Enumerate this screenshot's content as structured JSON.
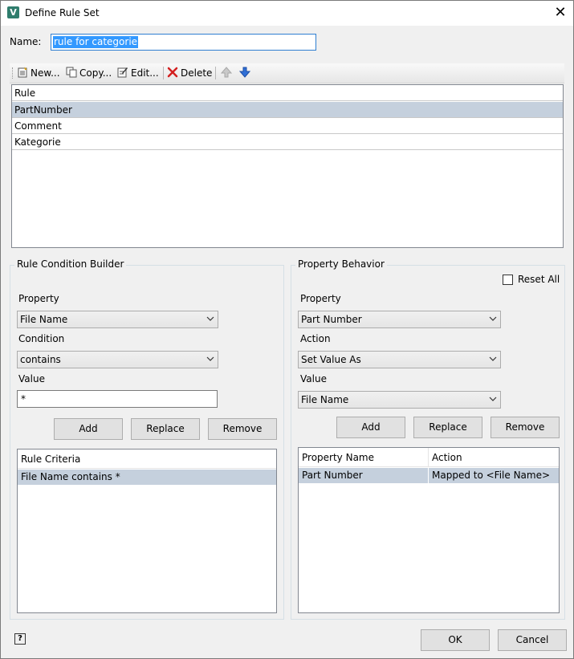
{
  "window": {
    "title": "Define Rule Set",
    "app_icon_letter": "V",
    "close_glyph": "✕"
  },
  "name_field": {
    "label": "Name:",
    "value": "rule for categorie"
  },
  "toolbar": {
    "new_label": "New...",
    "copy_label": "Copy...",
    "edit_label": "Edit...",
    "delete_label": "Delete"
  },
  "rules": {
    "header": "Rule",
    "items": [
      "PartNumber",
      "Comment",
      "Kategorie"
    ],
    "selected_index": 0
  },
  "condition_builder": {
    "title": "Rule Condition Builder",
    "property_label": "Property",
    "property_value": "File Name",
    "condition_label": "Condition",
    "condition_value": "contains",
    "value_label": "Value",
    "value_text": "*",
    "add_label": "Add",
    "replace_label": "Replace",
    "remove_label": "Remove",
    "criteria_header": "Rule Criteria",
    "criteria_items": [
      "File Name contains *"
    ]
  },
  "property_behavior": {
    "title": "Property Behavior",
    "reset_all_label": "Reset All",
    "reset_all_checked": false,
    "property_label": "Property",
    "property_value": "Part Number",
    "action_label": "Action",
    "action_value": "Set Value As",
    "value_label": "Value",
    "value_value": "File Name",
    "add_label": "Add",
    "replace_label": "Replace",
    "remove_label": "Remove",
    "columns": [
      "Property Name",
      "Action"
    ],
    "rows": [
      {
        "property_name": "Part Number",
        "action": "Mapped to <File Name>"
      }
    ]
  },
  "footer": {
    "help_glyph": "?",
    "ok_label": "OK",
    "cancel_label": "Cancel"
  }
}
